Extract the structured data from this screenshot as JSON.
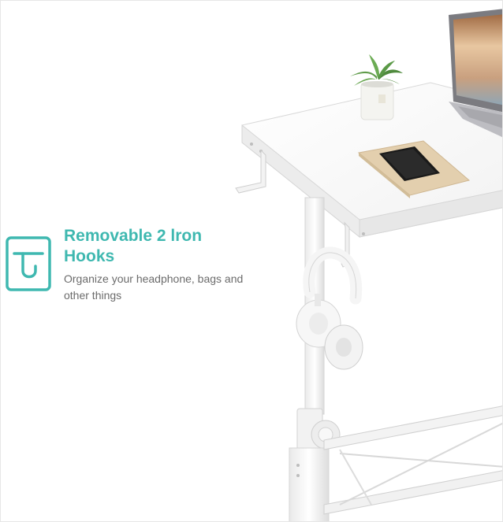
{
  "feature": {
    "title": "Removable 2 lron Hooks",
    "description": "Organize your headphone, bags and other things",
    "icon": "hook-icon",
    "accent_color": "#3fb8b0",
    "text_color": "#6b6b6b"
  },
  "scene": {
    "objects": [
      "desk",
      "laptop",
      "potted-plant",
      "smartphone",
      "notebook",
      "headphones",
      "hooks",
      "frame-legs"
    ]
  }
}
